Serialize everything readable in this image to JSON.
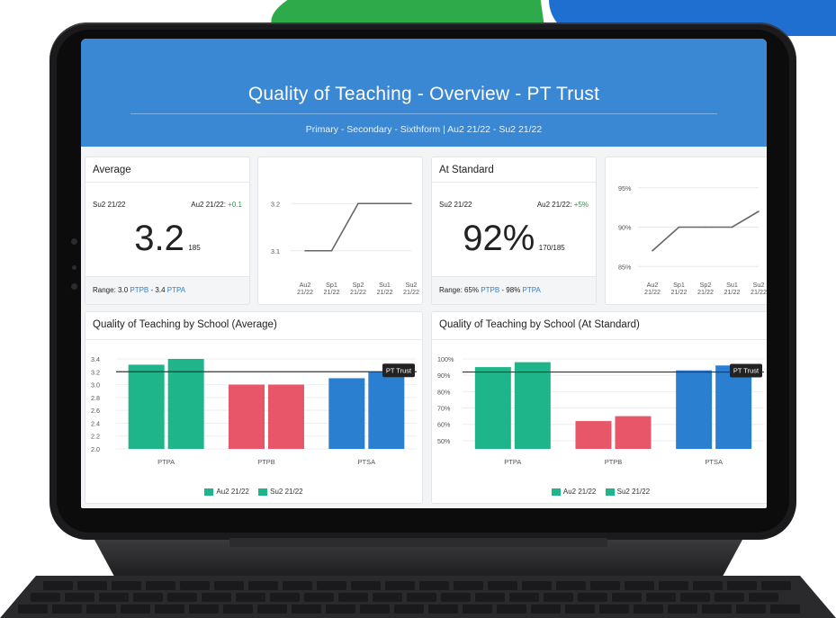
{
  "header": {
    "title": "Quality of Teaching - Overview - PT Trust",
    "subtitle": "Primary - Secondary - Sixthform | Au2 21/22 - Su2 21/22"
  },
  "colors": {
    "header_blue": "#3a87d4",
    "green": "#1fb58a",
    "red": "#e8566a",
    "blue": "#2b7fd1",
    "link": "#2d7fd3"
  },
  "average_card": {
    "title": "Average",
    "left_period": "Su2 21/22",
    "right_period": "Au2 21/22:",
    "delta": "+0.1",
    "value": "3.2",
    "count": "185",
    "range_prefix": "Range: 3.0",
    "range_min_school": "PTPB",
    "range_mid": "- 3.4",
    "range_max_school": "PTPA"
  },
  "standard_card": {
    "title": "At Standard",
    "left_period": "Su2 21/22",
    "right_period": "Au2 21/22:",
    "delta": "+5%",
    "value": "92%",
    "count": "170/185",
    "range_prefix": "Range: 65%",
    "range_min_school": "PTPB",
    "range_mid": "- 98%",
    "range_max_school": "PTPA"
  },
  "chart_data": [
    {
      "type": "line",
      "categories": [
        "Au2\n21/22",
        "Sp1\n21/22",
        "Sp2\n21/22",
        "Su1\n21/22",
        "Su2\n21/22"
      ],
      "series": [
        {
          "values": [
            3.1,
            3.1,
            3.2,
            3.2,
            3.2
          ]
        }
      ],
      "yticks": [
        "3.2",
        "3.1"
      ],
      "ylim": [
        3.05,
        3.25
      ],
      "grid": true
    },
    {
      "type": "line",
      "categories": [
        "Au2\n21/22",
        "Sp1\n21/22",
        "Sp2\n21/22",
        "Su1\n21/22",
        "Su2\n21/22"
      ],
      "series": [
        {
          "values": [
            87,
            90,
            90,
            90,
            92
          ]
        }
      ],
      "yticks": [
        "95%",
        "90%",
        "85%"
      ],
      "ylim": [
        84,
        96
      ],
      "grid": true
    },
    {
      "type": "bar",
      "title": "Quality of Teaching by School (Average)",
      "categories": [
        "PTPA",
        "PTPB",
        "PTSA"
      ],
      "series": [
        {
          "name": "Au2 21/22",
          "values": [
            3.31,
            3.0,
            3.1
          ]
        },
        {
          "name": "Su2 21/22",
          "values": [
            3.4,
            3.0,
            3.2
          ]
        }
      ],
      "yticks": [
        "3.4",
        "3.2",
        "3.0",
        "2.8",
        "2.6",
        "2.4",
        "2.2",
        "2.0"
      ],
      "ylim": [
        2.0,
        3.4
      ],
      "reference_line": {
        "label": "PT Trust",
        "value": 3.2
      },
      "legend": "bottom"
    },
    {
      "type": "bar",
      "title": "Quality of Teaching by School (At Standard)",
      "categories": [
        "PTPA",
        "PTPB",
        "PTSA"
      ],
      "series": [
        {
          "name": "Au2 21/22",
          "values": [
            95,
            62,
            93
          ]
        },
        {
          "name": "Su2 21/22",
          "values": [
            98,
            65,
            96
          ]
        }
      ],
      "yticks": [
        "100%",
        "90%",
        "80%",
        "70%",
        "60%",
        "50%"
      ],
      "ylim": [
        45,
        100
      ],
      "reference_line": {
        "label": "PT Trust",
        "value": 92
      },
      "legend": "bottom"
    }
  ]
}
